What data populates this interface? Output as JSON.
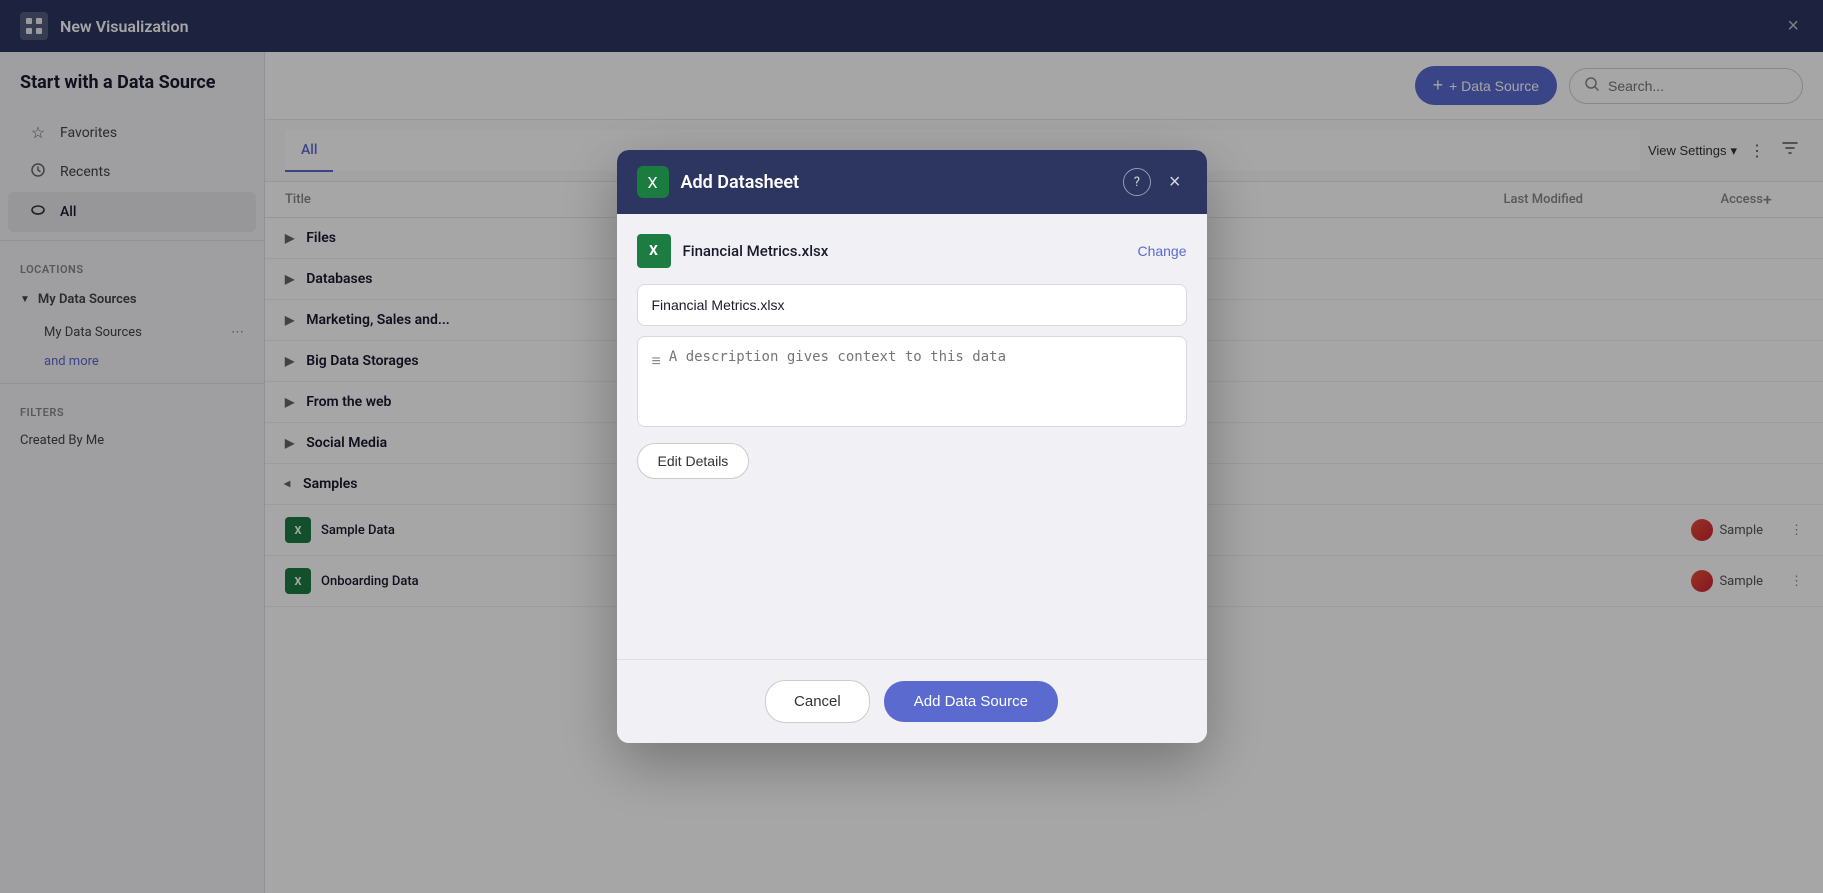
{
  "topbar": {
    "title": "New Visualization",
    "close_label": "×",
    "logo_icon": "grid-icon"
  },
  "sidebar": {
    "heading": "Start with a Data Source",
    "nav_items": [
      {
        "id": "favorites",
        "label": "Favorites",
        "icon": "★"
      },
      {
        "id": "recents",
        "label": "Recents",
        "icon": "🕐"
      },
      {
        "id": "all",
        "label": "All",
        "icon": "🗄"
      }
    ],
    "locations_label": "LOCATIONS",
    "locations_header": "My Data Sources",
    "locations_sub": "My Data Sources",
    "and_more": "and more",
    "filters_label": "FILTERS",
    "filter_item": "Created By Me"
  },
  "content": {
    "tab_all": "All",
    "add_datasource_label": "+ Data Source",
    "search_placeholder": "Search...",
    "view_settings": "View Settings",
    "col_title": "Title",
    "col_last_modified": "Last Modified",
    "col_access": "Access",
    "categories": [
      {
        "id": "files",
        "label": "Files",
        "expanded": false
      },
      {
        "id": "databases",
        "label": "Databases",
        "expanded": false
      },
      {
        "id": "marketing",
        "label": "Marketing, Sales and...",
        "expanded": false
      },
      {
        "id": "bigdata",
        "label": "Big Data Storages",
        "expanded": false
      },
      {
        "id": "web",
        "label": "From the web",
        "expanded": false
      },
      {
        "id": "social",
        "label": "Social Media",
        "expanded": false
      },
      {
        "id": "samples",
        "label": "Samples",
        "expanded": true
      }
    ],
    "rows": [
      {
        "id": "sample-data",
        "name": "Sample Data",
        "last_modified": "",
        "access": "Sample"
      },
      {
        "id": "onboarding-data",
        "name": "Onboarding Data",
        "last_modified": "",
        "access": "Sample"
      }
    ]
  },
  "modal": {
    "title": "Add Datasheet",
    "help_icon": "?",
    "close_icon": "×",
    "file_name": "Financial Metrics.xlsx",
    "change_label": "Change",
    "name_input_value": "Financial Metrics.xlsx",
    "description_placeholder": "A description gives context to this data",
    "edit_details_label": "Edit Details",
    "cancel_label": "Cancel",
    "add_source_label": "Add Data Source"
  }
}
